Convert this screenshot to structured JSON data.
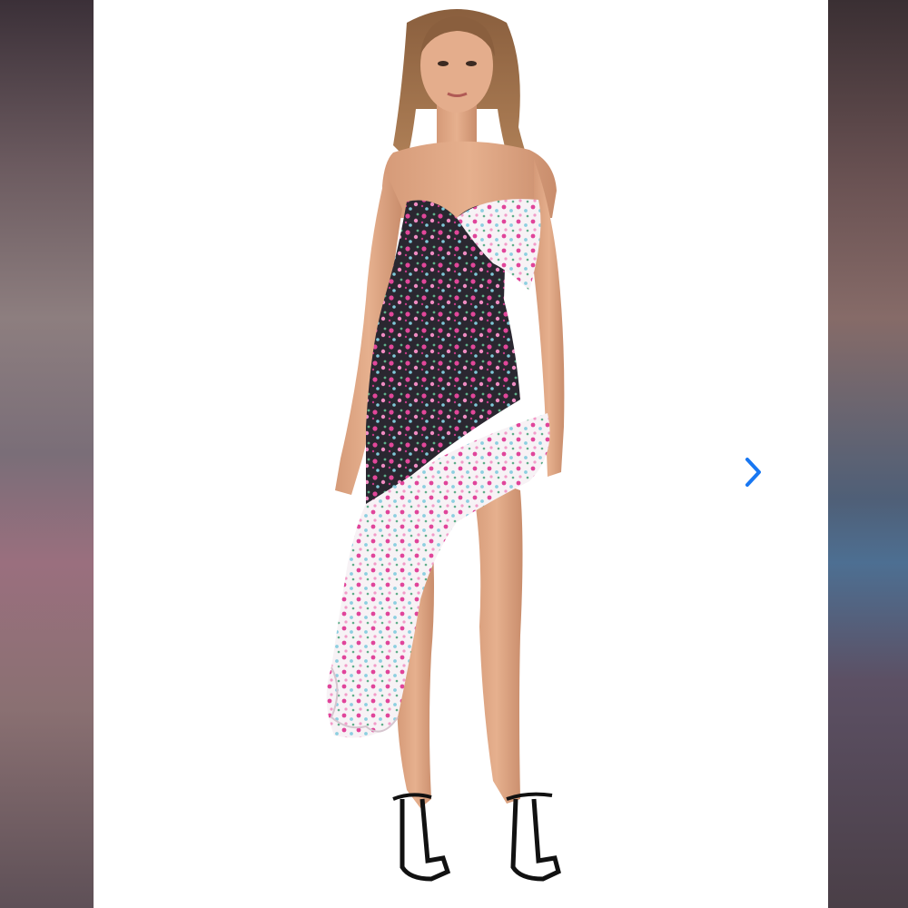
{
  "viewer": {
    "next_icon": "chevron-right-icon",
    "accent_color": "#1877f2"
  },
  "photo": {
    "subject": "model-in-floral-strapless-asymmetric-ruffle-dress"
  }
}
